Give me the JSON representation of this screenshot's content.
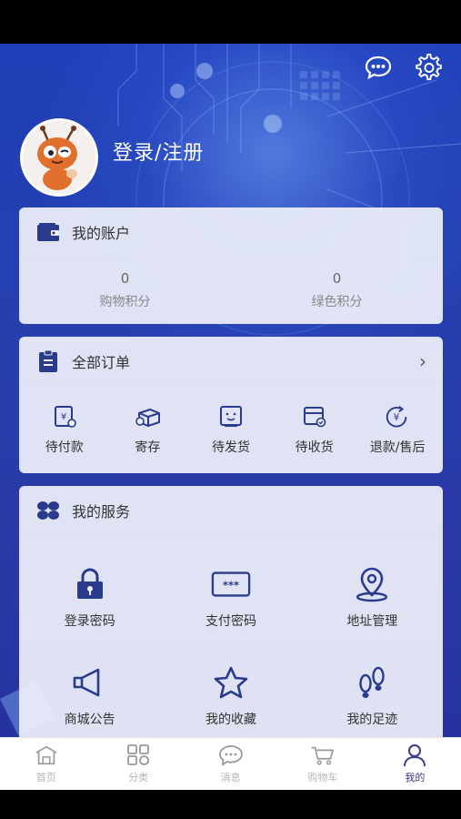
{
  "header": {
    "login_label": "登录/注册",
    "icons": [
      "chat-icon",
      "settings-icon"
    ]
  },
  "account": {
    "title": "我的账户",
    "items": [
      {
        "value": "0",
        "label": "购物积分"
      },
      {
        "value": "0",
        "label": "绿色积分"
      }
    ]
  },
  "orders": {
    "title": "全部订单",
    "chevron": "›",
    "items": [
      {
        "label": "待付款",
        "icon": "payment-pending-icon"
      },
      {
        "label": "寄存",
        "icon": "box-icon"
      },
      {
        "label": "待发货",
        "icon": "shipping-pending-icon"
      },
      {
        "label": "待收货",
        "icon": "receive-pending-icon"
      },
      {
        "label": "退款/售后",
        "icon": "refund-icon"
      }
    ]
  },
  "services": {
    "title": "我的服务",
    "items": [
      {
        "label": "登录密码",
        "icon": "lock-icon"
      },
      {
        "label": "支付密码",
        "icon": "password-icon"
      },
      {
        "label": "地址管理",
        "icon": "location-icon"
      },
      {
        "label": "商城公告",
        "icon": "megaphone-icon"
      },
      {
        "label": "我的收藏",
        "icon": "star-icon"
      },
      {
        "label": "我的足迹",
        "icon": "footprint-icon"
      }
    ]
  },
  "tabbar": {
    "items": [
      {
        "label": "首页",
        "icon": "home-icon"
      },
      {
        "label": "分类",
        "icon": "category-icon"
      },
      {
        "label": "消息",
        "icon": "message-icon"
      },
      {
        "label": "购物车",
        "icon": "cart-icon"
      },
      {
        "label": "我的",
        "icon": "profile-icon",
        "active": true
      }
    ]
  },
  "colors": {
    "accent": "#2a3a8c",
    "background": "#2540b0",
    "card": "#eef0fa"
  }
}
